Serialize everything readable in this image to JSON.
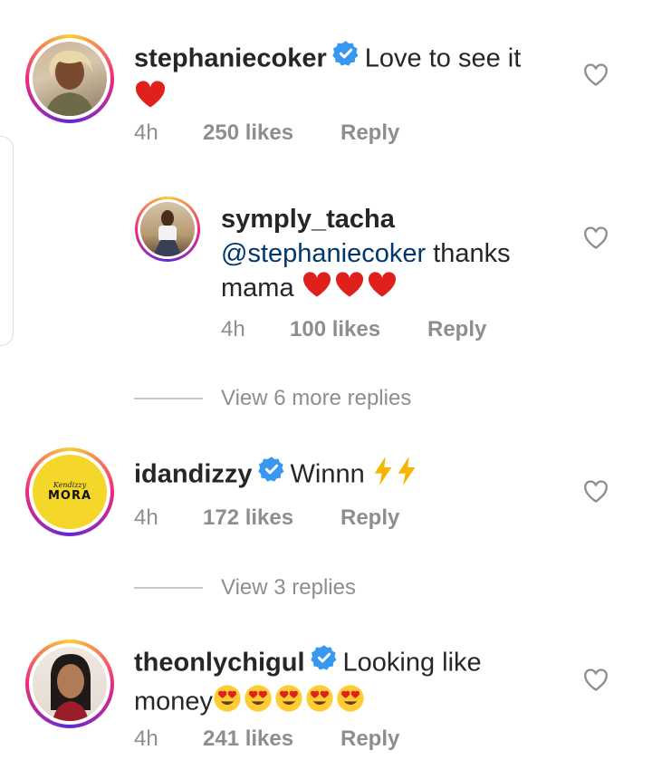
{
  "comments": [
    {
      "username": "stephaniecoker",
      "verified": true,
      "text": "Love to see it",
      "emoji": [
        "red-heart"
      ],
      "time": "4h",
      "likes": "250 likes",
      "reply": "Reply"
    },
    {
      "username": "symply_tacha",
      "verified": false,
      "mention": "@stephaniecoker",
      "text_line1": "thanks",
      "text_line2": "mama",
      "emoji": [
        "red-heart",
        "red-heart",
        "red-heart"
      ],
      "time": "4h",
      "likes": "100 likes",
      "reply": "Reply"
    },
    {
      "username": "idandizzy",
      "verified": true,
      "text": "Winnn",
      "emoji": [
        "lightning",
        "lightning"
      ],
      "avatar_text_top": "Kendizzy",
      "avatar_text_main": "MORA",
      "time": "4h",
      "likes": "172 likes",
      "reply": "Reply"
    },
    {
      "username": "theonlychigul",
      "verified": true,
      "text": "Looking like",
      "text_line2": "money",
      "emoji": [
        "heart-eyes",
        "heart-eyes",
        "heart-eyes",
        "heart-eyes",
        "heart-eyes"
      ],
      "time": "4h",
      "likes": "241 likes",
      "reply": "Reply"
    }
  ],
  "view_more": [
    {
      "label": "View 6 more replies"
    },
    {
      "label": "View 3 replies"
    }
  ],
  "colors": {
    "text": "#262626",
    "meta": "#8e8e8e",
    "mention": "#00376b",
    "verified": "#3897f0",
    "heart": "#ed4956"
  }
}
